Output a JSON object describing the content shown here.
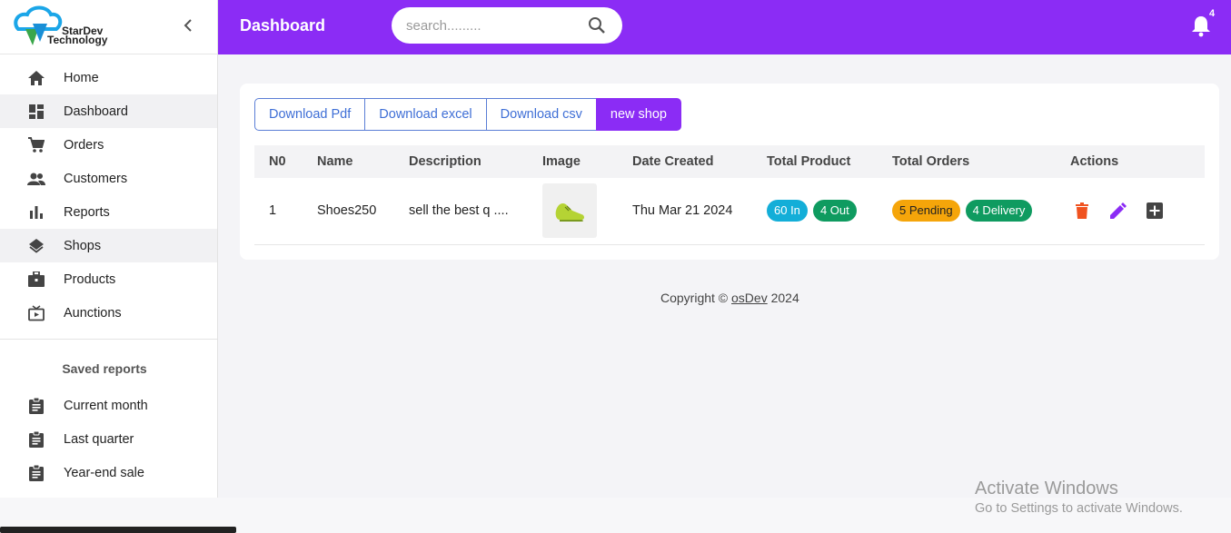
{
  "brand": {
    "line1": "StarDev",
    "line2": "Technology"
  },
  "header": {
    "title": "Dashboard",
    "search_placeholder": "search.........",
    "notification_count": "4",
    "color": "#8b2cf5"
  },
  "sidebar": {
    "items": [
      {
        "label": "Home",
        "icon": "home-icon"
      },
      {
        "label": "Dashboard",
        "icon": "dashboard-icon"
      },
      {
        "label": "Orders",
        "icon": "cart-icon"
      },
      {
        "label": "Customers",
        "icon": "people-icon"
      },
      {
        "label": "Reports",
        "icon": "bar-chart-icon"
      },
      {
        "label": "Shops",
        "icon": "layers-icon"
      },
      {
        "label": "Products",
        "icon": "briefcase-icon"
      },
      {
        "label": "Aunctions",
        "icon": "live-tv-icon"
      }
    ],
    "saved_reports": {
      "heading": "Saved reports",
      "items": [
        {
          "label": "Current month",
          "icon": "clipboard-icon"
        },
        {
          "label": "Last quarter",
          "icon": "clipboard-icon"
        },
        {
          "label": "Year-end sale",
          "icon": "clipboard-icon"
        }
      ]
    }
  },
  "toolbar": {
    "download_pdf": "Download Pdf",
    "download_excel": "Download excel",
    "download_csv": "Download csv",
    "new_shop": "new shop"
  },
  "table": {
    "headers": [
      "N0",
      "Name",
      "Description",
      "Image",
      "Date Created",
      "Total Product",
      "Total Orders",
      "Actions"
    ],
    "rows": [
      {
        "no": "1",
        "name": "Shoes250",
        "description": "sell the best q ....",
        "image": "shoe-image",
        "date_created": "Thu Mar 21 2024",
        "product_in": "60 In",
        "product_out": "4 Out",
        "orders_pending": "5 Pending",
        "orders_delivery": "4 Delivery"
      }
    ]
  },
  "footer": {
    "prefix": "Copyright ©",
    "link": "osDev",
    "year": "2024"
  },
  "watermark": {
    "line1": "Activate Windows",
    "line2": "Go to Settings to activate Windows."
  }
}
